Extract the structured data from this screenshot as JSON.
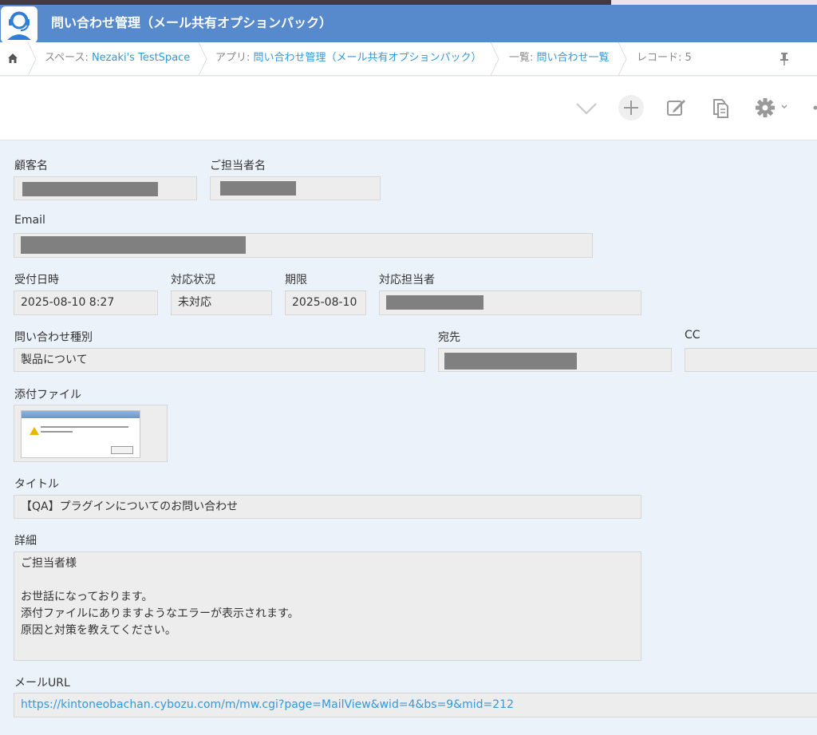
{
  "app": {
    "title": "問い合わせ管理（メール共有オプションパック）",
    "icon": "support-agent-icon"
  },
  "breadcrumb": {
    "home_icon": "home-icon",
    "space_prefix": "スペース: ",
    "space_name": "Nezaki's TestSpace",
    "app_prefix": "アプリ: ",
    "app_name": "問い合わせ管理（メール共有オプションパック）",
    "view_prefix": "一覧: ",
    "view_name": "問い合わせ一覧",
    "record": "レコード: 5",
    "pin_icon": "pin-icon"
  },
  "toolbar": {
    "icons": [
      "chevron-down-icon",
      "plus-icon",
      "edit-icon",
      "copy-icon",
      "gear-icon",
      "more-icon"
    ]
  },
  "record": {
    "customer_name": {
      "label": "顧客名",
      "value_redacted": true
    },
    "contact_name": {
      "label": "ご担当者名",
      "value_redacted": true
    },
    "email": {
      "label": "Email",
      "value_redacted": true
    },
    "received_at": {
      "label": "受付日時",
      "value": "2025-08-10 8:27"
    },
    "status": {
      "label": "対応状況",
      "value": "未対応"
    },
    "deadline": {
      "label": "期限",
      "value": "2025-08-10"
    },
    "assignee": {
      "label": "対応担当者",
      "value_redacted": true
    },
    "inquiry_type": {
      "label": "問い合わせ種別",
      "value": "製品について"
    },
    "to": {
      "label": "宛先",
      "value_redacted": true
    },
    "cc": {
      "label": "CC",
      "value": ""
    },
    "attachment": {
      "label": "添付ファイル"
    },
    "subject": {
      "label": "タイトル",
      "value": "【QA】プラグインについてのお問い合わせ"
    },
    "details": {
      "label": "詳細",
      "value": "ご担当者様\n\nお世話になっております。\n添付ファイルにありますようなエラーが表示されます。\n原因と対策を教えてください。"
    },
    "mail_url": {
      "label": "メールURL",
      "value": "https://kintoneobachan.cybozu.com/m/mw.cgi?page=MailView&wid=4&bs=9&mid=212"
    }
  },
  "colors": {
    "header": "#5789cd",
    "form_bg": "#ebf2fa",
    "field_bg": "#ededed",
    "link": "#3498db",
    "redaction": "#808080"
  }
}
